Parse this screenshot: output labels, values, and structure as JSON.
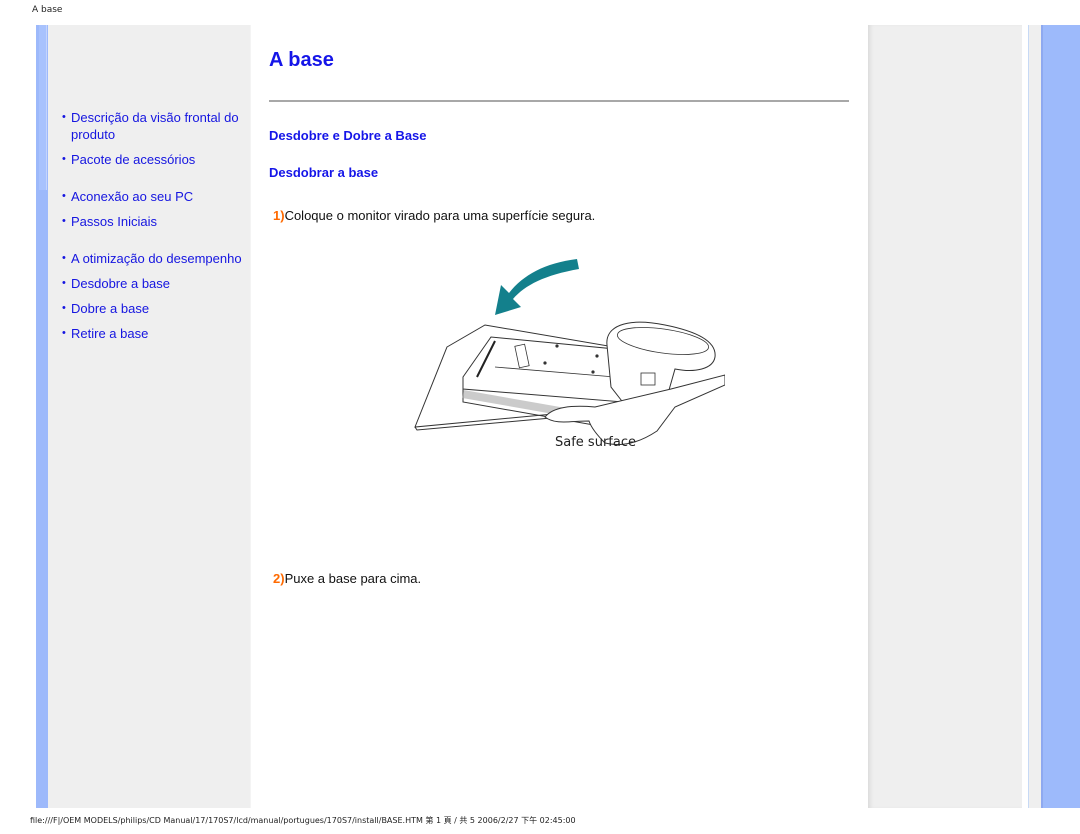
{
  "page": {
    "header_title": "A base",
    "footer_text": "file:///F|/OEM MODELS/philips/CD Manual/17/170S7/lcd/manual/portugues/170S7/install/BASE.HTM 第 1 頁 / 共 5 2006/2/27 下午 02:45:00"
  },
  "sidebar": {
    "items": [
      {
        "label": "Descrição da visão frontal do produto"
      },
      {
        "label": "Pacote de acessórios"
      },
      {
        "label": "Aconexão ao seu PC"
      },
      {
        "label": "Passos Iniciais"
      },
      {
        "label": "A otimização do desempenho"
      },
      {
        "label": "Desdobre a base"
      },
      {
        "label": "Dobre a base"
      },
      {
        "label": "Retire a base"
      }
    ]
  },
  "content": {
    "title": "A base",
    "section_heading": "Desdobre e Dobre a Base",
    "subsection_heading": "Desdobrar a base",
    "steps": [
      {
        "number": "1)",
        "text": "Coloque o monitor virado para uma superfície segura."
      },
      {
        "number": "2)",
        "text": "Puxe a base para cima."
      }
    ],
    "figure": {
      "caption": "Safe surface",
      "description": "monitor-face-down-on-safe-surface-illustration"
    }
  },
  "colors": {
    "link": "#1515e0",
    "heading": "#1515e8",
    "step_number": "#ff6a00",
    "accent_bar": "#9dbafb",
    "panel": "#efefef",
    "arrow": "#13808c"
  }
}
